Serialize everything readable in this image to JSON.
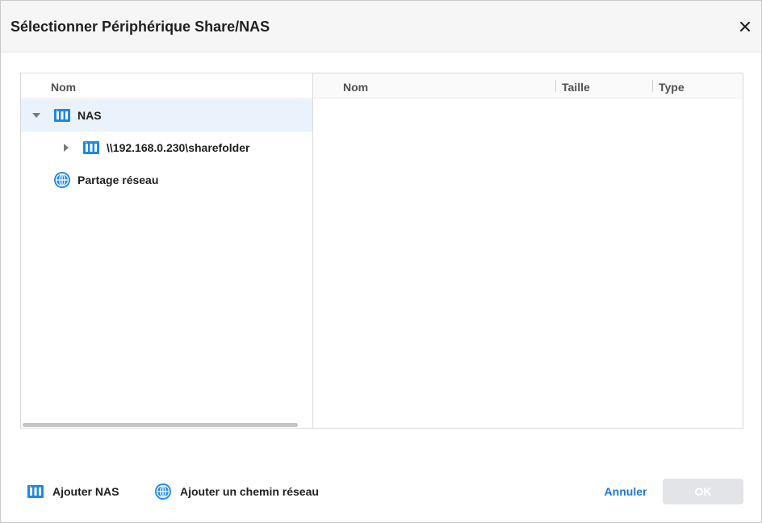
{
  "dialog": {
    "title": "Sélectionner Périphérique Share/NAS",
    "close_icon": "close-icon"
  },
  "tree": {
    "header": "Nom",
    "items": [
      {
        "label": "NAS",
        "icon": "nas-icon",
        "expanded": true,
        "selected": true,
        "level": 0
      },
      {
        "label": "\\\\192.168.0.230\\sharefolder",
        "icon": "nas-icon",
        "expanded": false,
        "selected": false,
        "level": 1
      },
      {
        "label": "Partage réseau",
        "icon": "globe-icon",
        "expanded": false,
        "selected": false,
        "level": 0
      }
    ]
  },
  "details": {
    "columns": [
      "Nom",
      "Taille",
      "Type"
    ]
  },
  "footer": {
    "add_nas_label": "Ajouter NAS",
    "add_network_path_label": "Ajouter un chemin réseau",
    "cancel_label": "Annuler",
    "ok_label": "OK"
  },
  "colors": {
    "accent": "#1a7ad9",
    "icon_blue": "#1e88e5",
    "selected_row": "#eaf2fb",
    "disabled_button": "#e3e4e7"
  }
}
